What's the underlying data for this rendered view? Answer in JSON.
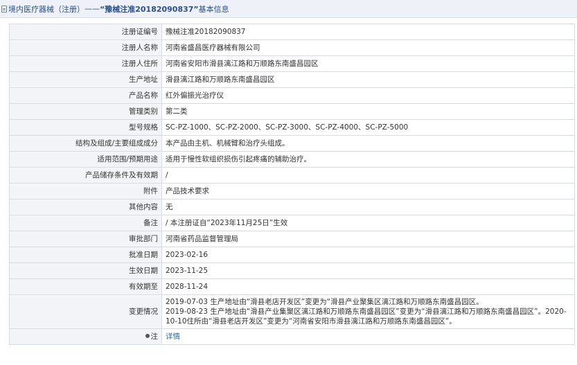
{
  "header": {
    "prefix": "境内医疗器械（注册）",
    "separator": " —— ",
    "reg_no_quoted": "“豫械注准20182090837”",
    "suffix": "基本信息"
  },
  "rows": [
    {
      "label": "注册证编号",
      "value": "豫械注准20182090837"
    },
    {
      "label": "注册人名称",
      "value": "河南省盛昌医疗器械有限公司"
    },
    {
      "label": "注册人住所",
      "value": "河南省安阳市滑县漓江路和万顺路东南盛昌园区"
    },
    {
      "label": "生产地址",
      "value": "滑县漓江路和万顺路东南盛昌园区"
    },
    {
      "label": "产品名称",
      "value": "红外偏振光治疗仪"
    },
    {
      "label": "管理类别",
      "value": "第二类"
    },
    {
      "label": "型号规格",
      "value": "SC-PZ-1000、SC-PZ-2000、SC-PZ-3000、SC-PZ-4000、SC-PZ-5000"
    },
    {
      "label": "结构及组成/主要组成成分",
      "value": "本产品由主机、机械臂和治疗头组成。"
    },
    {
      "label": "适用范围/预期用途",
      "value": "适用于慢性软组织损伤引起疼痛的辅助治疗。"
    },
    {
      "label": "产品储存条件及有效期",
      "value": "/"
    },
    {
      "label": "附件",
      "value": "产品技术要求"
    },
    {
      "label": "其他内容",
      "value": "无"
    },
    {
      "label": "备注",
      "value": "/ 本注册证自“2023年11月25日”生效"
    },
    {
      "label": "审批部门",
      "value": "河南省药品监督管理局"
    },
    {
      "label": "批准日期",
      "value": "2023-02-16"
    },
    {
      "label": "生效日期",
      "value": "2023-11-25"
    },
    {
      "label": "有效期至",
      "value": "2028-11-24"
    }
  ],
  "changes": {
    "label": "变更情况",
    "lines": [
      "2019-07-03 生产地址由“滑县老店开发区”变更为“滑县产业聚集区漓江路和万顺路东南盛昌园区。",
      "2019-08-23 生产地址由“滑县产业集聚区漓江路和万顺路东南盛昌园区”变更为“滑县漓江路和万顺路东南盛昌园区”。2020-10-10住所由“滑县老店开发区”变更为“河南省安阳市滑县漓江路和万顺路东南盛昌园区”。"
    ]
  },
  "note": {
    "label": "注",
    "link_text": "详情",
    "icon": "bullet-icon"
  },
  "colors": {
    "header_bg": "#eef2f8",
    "header_text": "#2a4f8f",
    "label_bg": "#f2f4f7",
    "border": "#d6dce6",
    "link": "#2b6cb8"
  }
}
